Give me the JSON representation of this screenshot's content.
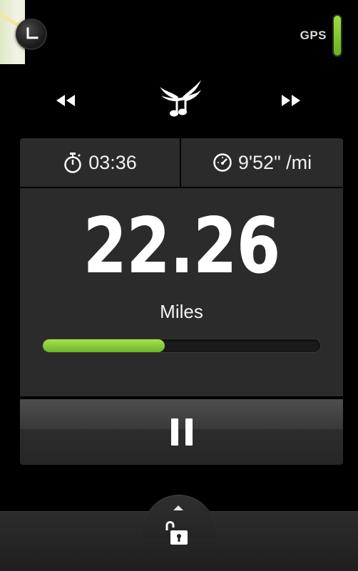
{
  "status": {
    "gps_label": "GPS"
  },
  "media": {
    "prev": "rewind-icon",
    "logo": "winged-music-note-logo",
    "next": "fast-forward-icon"
  },
  "stats": {
    "elapsed_time": "03:36",
    "pace": "9'52\" /mi"
  },
  "workout": {
    "distance": "22.26",
    "unit": "Miles",
    "progress_fraction": 0.44
  },
  "colors": {
    "accent_green": "#7cc633",
    "panel_bg": "#2b2b2b",
    "background": "#000000"
  },
  "controls": {
    "pause": "pause-icon",
    "unlock": "unlock-icon"
  }
}
